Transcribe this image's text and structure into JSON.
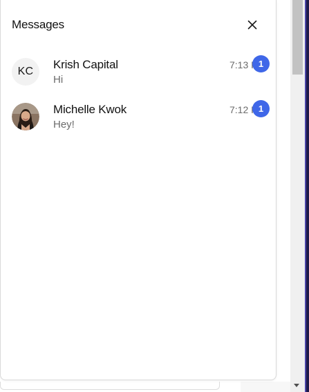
{
  "panel": {
    "title": "Messages",
    "close_icon": "close-icon"
  },
  "conversations": [
    {
      "name": "Krish Capital",
      "preview": "Hi",
      "time": "7:13 PM",
      "unread": "1",
      "avatar": {
        "type": "initials",
        "initials": "KC"
      }
    },
    {
      "name": "Michelle Kwok",
      "preview": "Hey!",
      "time": "7:12 PM",
      "unread": "1",
      "avatar": {
        "type": "photo",
        "icon": "profile-photo"
      }
    }
  ],
  "colors": {
    "badge": "#3f67e8",
    "text_primary": "#111111",
    "text_secondary": "#6b6b6b"
  }
}
